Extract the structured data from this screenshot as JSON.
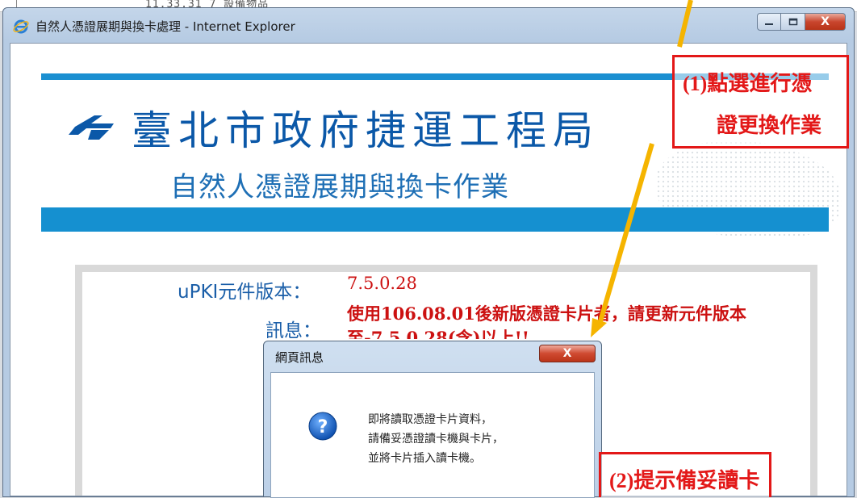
{
  "background_document": {
    "text": "11.33.31 7 設備物品"
  },
  "window": {
    "title": "自然人憑證展期與換卡處理 - Internet Explorer",
    "controls": {
      "minimize": "—",
      "maximize": "□",
      "close": "X"
    }
  },
  "page": {
    "organization": "臺北市政府捷運工程局",
    "subtitle": "自然人憑證展期與換卡作業",
    "version_label": "uPKI元件版本：",
    "version_value": "7.5.0.28",
    "message_label": "訊息：",
    "message_value": "使用106.08.01後新版憑證卡片者，請更新元件版本至-7.5.0.28(含)以上!!"
  },
  "dialog": {
    "title": "網頁訊息",
    "close_label": "X",
    "lines": [
      "即將讀取憑證卡片資料，",
      "請備妥憑證讀卡機與卡片，",
      "並將卡片插入讀卡機。"
    ]
  },
  "annotations": {
    "step1_line1": "(1)點選進行憑",
    "step1_line2": "證更換作業",
    "step2": "(2)提示備妥讀卡"
  },
  "colors": {
    "annotation_red": "#e31818",
    "arrow_yellow": "#f5b400",
    "brand_blue": "#1590d0",
    "message_red": "#cc1111"
  }
}
